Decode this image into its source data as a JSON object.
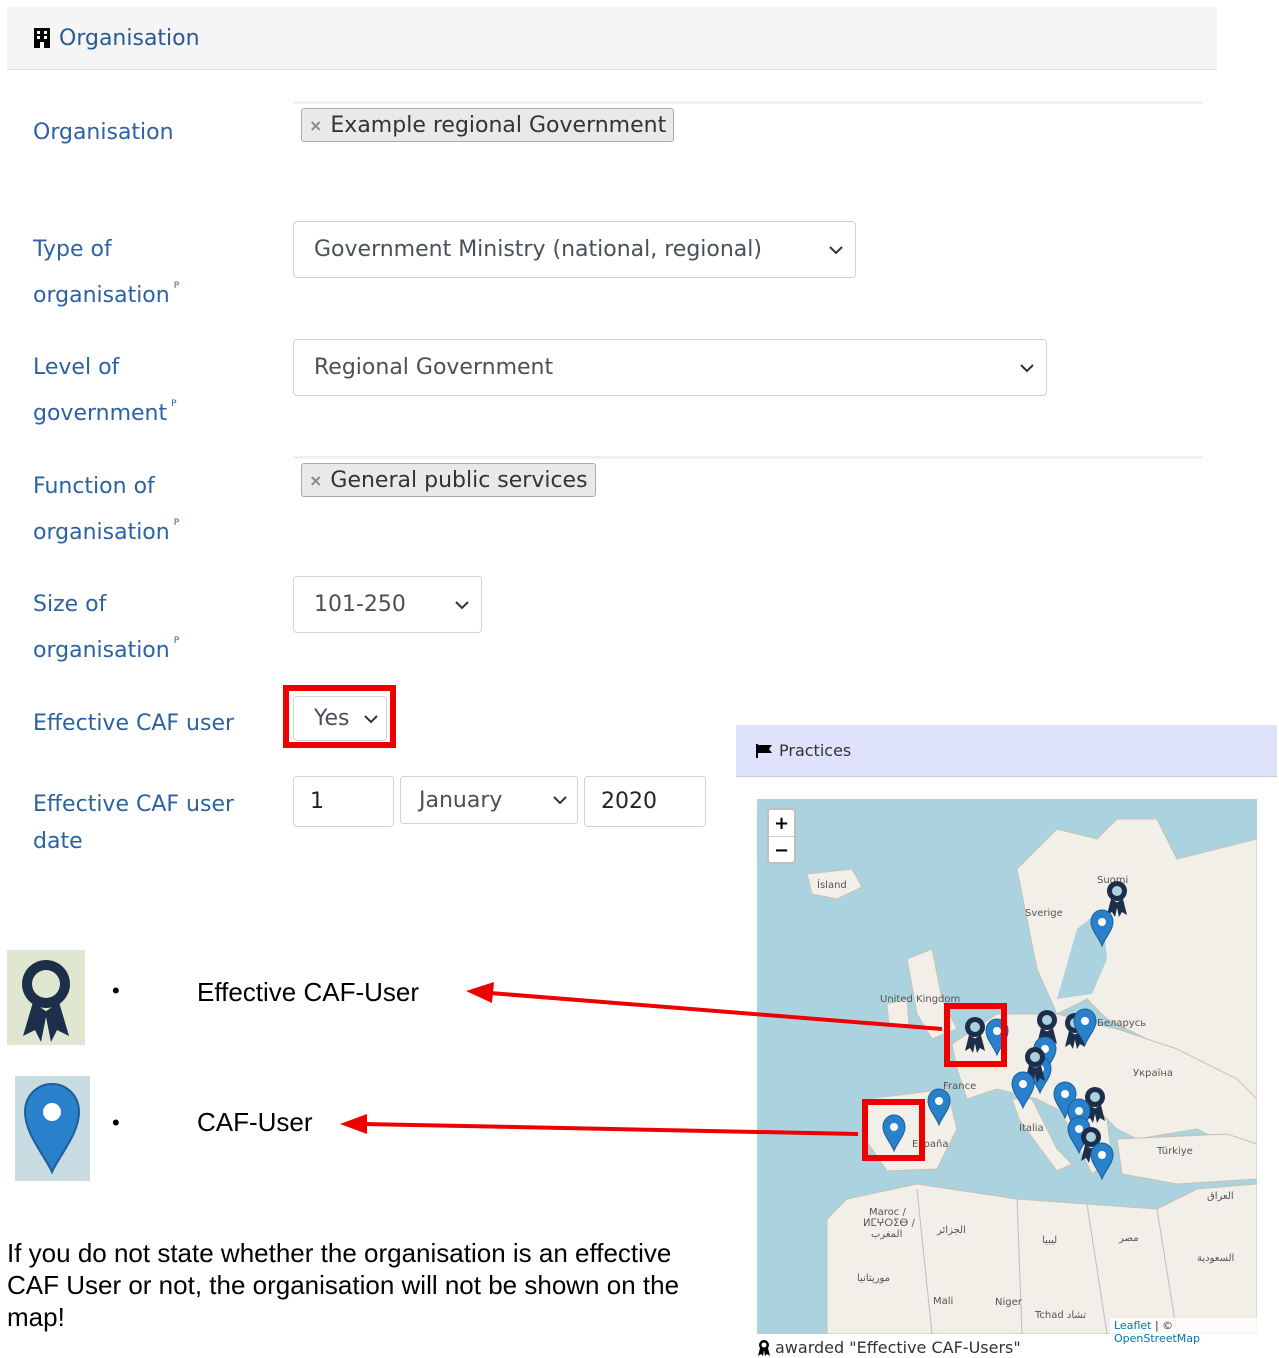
{
  "header": {
    "title": "Organisation",
    "icon": "building-icon"
  },
  "form": {
    "organisation": {
      "label": "Organisation",
      "tag": "Example regional Government",
      "remove_glyph": "×"
    },
    "type": {
      "label_line1": "Type of",
      "label_line2": "organisation",
      "marker": "P",
      "value": "Government Ministry (national, regional)"
    },
    "level": {
      "label_line1": "Level of",
      "label_line2": "government",
      "marker": "P",
      "value": "Regional Government"
    },
    "function": {
      "label_line1": "Function of",
      "label_line2": "organisation",
      "marker": "P",
      "tag": "General public services",
      "remove_glyph": "×"
    },
    "size": {
      "label_line1": "Size of",
      "label_line2": "organisation",
      "marker": "P",
      "value": "101-250"
    },
    "effective": {
      "label": "Effective CAF user",
      "value": "Yes"
    },
    "effective_date": {
      "label_line1": "Effective CAF user",
      "label_line2": "date",
      "day": "1",
      "month": "January",
      "year": "2020"
    }
  },
  "legend": {
    "bullet": "•",
    "effective_caf_user": "Effective CAF-User",
    "caf_user": "CAF-User",
    "note": "If you do not state whether the organisation is an effective CAF User or not, the organisation will not be shown on the map!"
  },
  "practices": {
    "title": "Practices",
    "zoom_in": "+",
    "zoom_out": "−",
    "attribution_leaflet": "Leaflet",
    "attribution_sep": " | © ",
    "attribution_osm": "OpenStreetMap",
    "awarded": "awarded \"Effective CAF-Users\"",
    "map_labels": {
      "island": "Ísland",
      "sverige": "Sverige",
      "suomi": "Suomi",
      "uk": "United Kingdom",
      "belarus": "Беларусь",
      "ukraine": "Україна",
      "france": "France",
      "italia": "Italia",
      "espana": "España",
      "turkiye": "Türkiye",
      "iraq": "العراق",
      "maroc": "Maroc /",
      "maroc2": "ⵍⵎⵖⵔⵉⴱ /",
      "maroc3": "المغرب",
      "algeria": "الجزائر",
      "libya": "ليبيا",
      "egypt": "مصر",
      "saudi": "السعودية",
      "mauritania": "موريتانيا",
      "mali": "Mali",
      "niger": "Niger",
      "tchad": "Tchad تشاد"
    }
  },
  "colors": {
    "accent": "#2c62a3",
    "highlight": "#ee0000",
    "marker_blue": "#2a81cb",
    "marker_dark": "#1c2e4a",
    "sea": "#aad3df",
    "land": "#f2efe9"
  }
}
